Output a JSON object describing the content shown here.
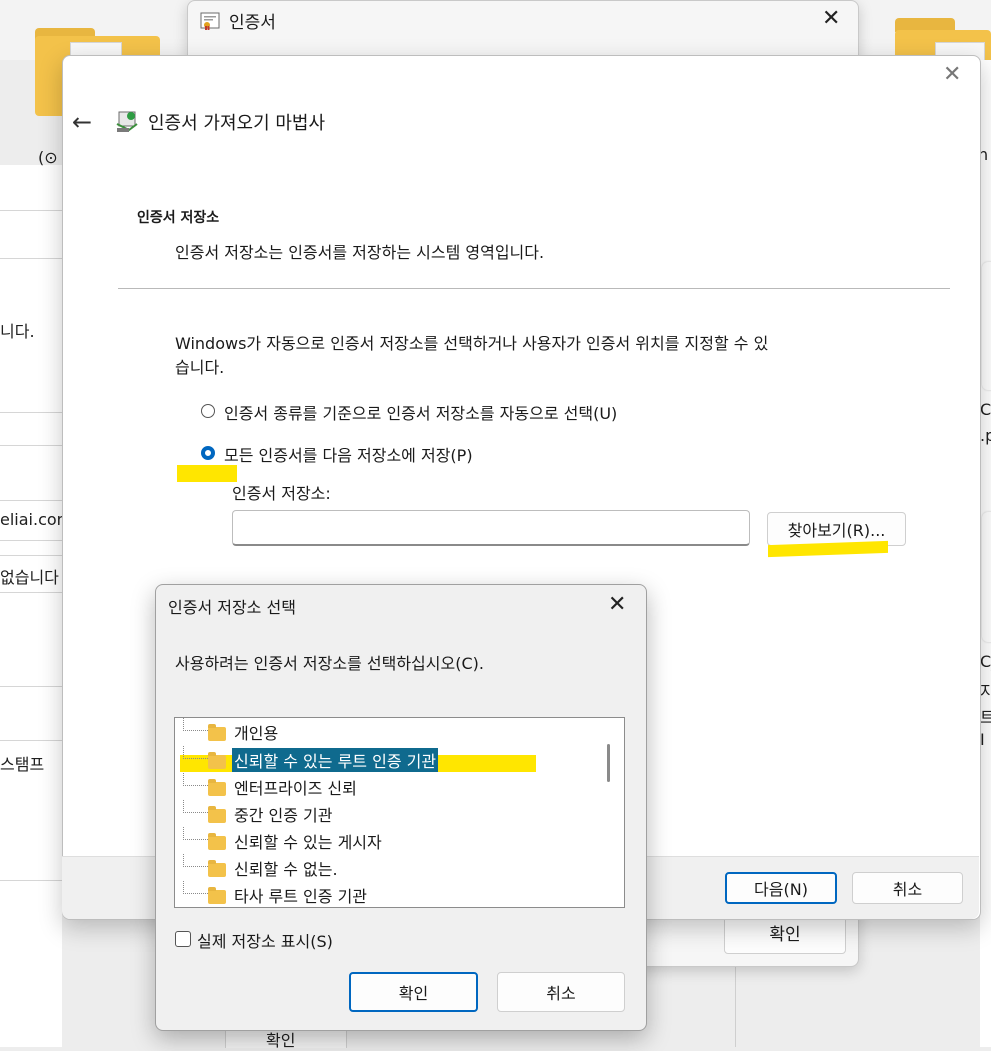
{
  "background": {
    "left_texts": [
      "(⊙",
      "니다.",
      "eliai.com",
      "없습니다",
      "스탬프"
    ],
    "right_texts": [
      "n",
      "C",
      ".p",
      "C_",
      "지",
      "트",
      "I"
    ],
    "bottom_ok": "확인"
  },
  "cert_window": {
    "title": "인증서",
    "close_icon": "✕",
    "ok_label": "확인"
  },
  "wizard": {
    "close_icon": "✕",
    "back_icon": "←",
    "title": "인증서 가져오기 마법사",
    "section_title": "인증서 저장소",
    "section_desc": "인증서 저장소는 인증서를 저장하는 시스템 영역입니다.",
    "intro_line1": "Windows가 자동으로 인증서 저장소를 선택하거나 사용자가 인증서 위치를 지정할 수 있",
    "intro_line2": "습니다.",
    "option_auto": "인증서 종류를 기준으로 인증서 저장소를 자동으로 선택(U)",
    "option_manual": "모든 인증서를 다음 저장소에 저장(P)",
    "store_label": "인증서 저장소:",
    "store_value": "",
    "browse_label": "찾아보기(R)...",
    "next_label": "다음(N)",
    "cancel_label": "취소"
  },
  "store_dialog": {
    "title": "인증서 저장소 선택",
    "close_icon": "✕",
    "prompt": "사용하려는 인증서 저장소를 선택하십시오(C).",
    "stores": [
      {
        "label": "개인용",
        "selected": false
      },
      {
        "label": "신뢰할 수 있는 루트 인증 기관",
        "selected": true
      },
      {
        "label": "엔터프라이즈 신뢰",
        "selected": false
      },
      {
        "label": "중간 인증 기관",
        "selected": false
      },
      {
        "label": "신뢰할 수 있는 게시자",
        "selected": false
      },
      {
        "label": "신뢰할 수 없는.",
        "selected": false
      },
      {
        "label": "타사 루트 인증 기관",
        "selected": false
      }
    ],
    "show_physical_label": "실제 저장소 표시(S)",
    "ok_label": "확인",
    "cancel_label": "취소"
  },
  "colors": {
    "accent": "#0067c0",
    "selection": "#0f6a8e",
    "highlight": "#ffe600",
    "folder": "#f3c24a"
  }
}
